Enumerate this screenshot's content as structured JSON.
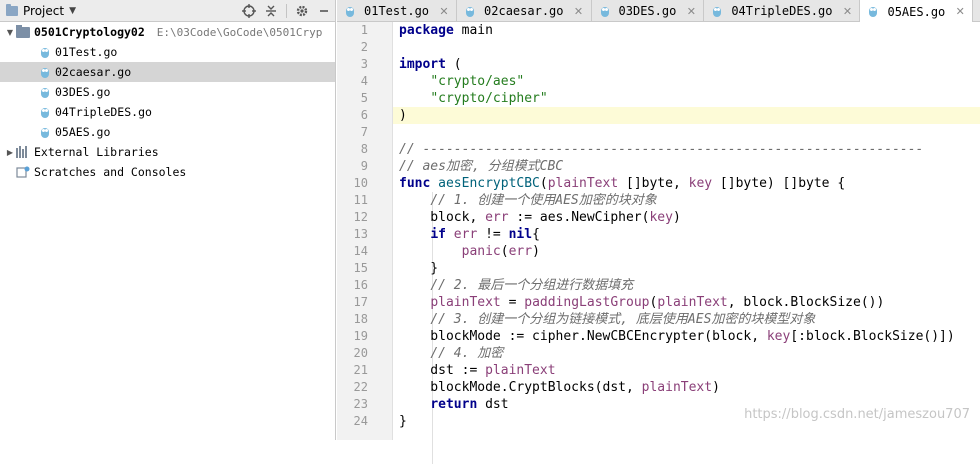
{
  "project_panel": {
    "title": "Project",
    "tree": [
      {
        "kind": "folder",
        "label": "0501Cryptology02",
        "path": "E:\\03Code\\GoCode\\0501Cryp",
        "indent": 0,
        "expanded": true,
        "bold": true
      },
      {
        "kind": "go",
        "label": "01Test.go",
        "indent": 1
      },
      {
        "kind": "go",
        "label": "02caesar.go",
        "indent": 1,
        "selected": true
      },
      {
        "kind": "go",
        "label": "03DES.go",
        "indent": 1
      },
      {
        "kind": "go",
        "label": "04TripleDES.go",
        "indent": 1
      },
      {
        "kind": "go",
        "label": "05AES.go",
        "indent": 1
      },
      {
        "kind": "libs",
        "label": "External Libraries",
        "indent": 0,
        "collapsed": true
      },
      {
        "kind": "scratch",
        "label": "Scratches and Consoles",
        "indent": 0
      }
    ]
  },
  "tabs": [
    {
      "label": "01Test.go"
    },
    {
      "label": "02caesar.go"
    },
    {
      "label": "03DES.go"
    },
    {
      "label": "04TripleDES.go"
    },
    {
      "label": "05AES.go",
      "active": true
    }
  ],
  "editor": {
    "current_line": 6,
    "lines": [
      [
        [
          "k",
          "package"
        ],
        [
          "t",
          " main"
        ]
      ],
      [],
      [
        [
          "k",
          "import"
        ],
        [
          "t",
          " ("
        ]
      ],
      [
        [
          "t",
          "    "
        ],
        [
          "s",
          "\"crypto/aes\""
        ]
      ],
      [
        [
          "t",
          "    "
        ],
        [
          "s",
          "\"crypto/cipher\""
        ]
      ],
      [
        [
          "t",
          ")"
        ]
      ],
      [],
      [
        [
          "c",
          "// ----------------------------------------------------------------"
        ]
      ],
      [
        [
          "c",
          "// aes加密, 分组模式CBC"
        ]
      ],
      [
        [
          "k",
          "func"
        ],
        [
          "t",
          " "
        ],
        [
          "fn",
          "aesEncryptCBC"
        ],
        [
          "t",
          "("
        ],
        [
          "p",
          "plainText"
        ],
        [
          "t",
          " []byte, "
        ],
        [
          "p",
          "key"
        ],
        [
          "t",
          " []byte) []byte {"
        ]
      ],
      [
        [
          "t",
          "    "
        ],
        [
          "c",
          "// 1. 创建一个使用AES加密的块对象"
        ]
      ],
      [
        [
          "t",
          "    block, "
        ],
        [
          "v",
          "err"
        ],
        [
          "t",
          " := aes.NewCipher("
        ],
        [
          "p",
          "key"
        ],
        [
          "t",
          ")"
        ]
      ],
      [
        [
          "t",
          "    "
        ],
        [
          "k",
          "if"
        ],
        [
          "t",
          " "
        ],
        [
          "v",
          "err"
        ],
        [
          "t",
          " != "
        ],
        [
          "k",
          "nil"
        ],
        [
          "t",
          "{"
        ]
      ],
      [
        [
          "t",
          "        "
        ],
        [
          "v",
          "panic"
        ],
        [
          "t",
          "("
        ],
        [
          "v",
          "err"
        ],
        [
          "t",
          ")"
        ]
      ],
      [
        [
          "t",
          "    }"
        ]
      ],
      [
        [
          "t",
          "    "
        ],
        [
          "c",
          "// 2. 最后一个分组进行数据填充"
        ]
      ],
      [
        [
          "t",
          "    "
        ],
        [
          "p",
          "plainText"
        ],
        [
          "t",
          " = "
        ],
        [
          "v",
          "paddingLastGroup"
        ],
        [
          "t",
          "("
        ],
        [
          "p",
          "plainText"
        ],
        [
          "t",
          ", block.BlockSize())"
        ]
      ],
      [
        [
          "t",
          "    "
        ],
        [
          "c",
          "// 3. 创建一个分组为链接模式, 底层使用AES加密的块模型对象"
        ]
      ],
      [
        [
          "t",
          "    blockMode := cipher.NewCBCEncrypter(block, "
        ],
        [
          "p",
          "key"
        ],
        [
          "t",
          "[:block.BlockSize()])"
        ]
      ],
      [
        [
          "t",
          "    "
        ],
        [
          "c",
          "// 4. 加密"
        ]
      ],
      [
        [
          "t",
          "    dst := "
        ],
        [
          "p",
          "plainText"
        ]
      ],
      [
        [
          "t",
          "    blockMode.CryptBlocks(dst, "
        ],
        [
          "p",
          "plainText"
        ],
        [
          "t",
          ")"
        ]
      ],
      [
        [
          "t",
          "    "
        ],
        [
          "k",
          "return"
        ],
        [
          "t",
          " dst"
        ]
      ],
      [
        [
          "t",
          "}"
        ]
      ]
    ]
  },
  "watermark": "https://blog.csdn.net/jameszou707",
  "colors": {
    "keyword": "#00008b",
    "string": "#247c1e",
    "comment": "#6d6d6d",
    "param": "#8a3f78",
    "selection": "#d5d5d5",
    "current_line": "#fdfbd7"
  }
}
